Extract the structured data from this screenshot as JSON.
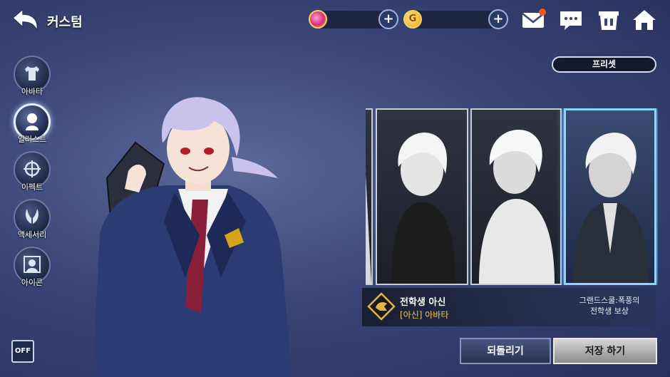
{
  "header": {
    "title": "커스텀",
    "gold_symbol": "G",
    "plus_label": "+"
  },
  "side_menu": [
    {
      "label": "아바타",
      "icon": "shirt-icon",
      "active": false
    },
    {
      "label": "일러스트",
      "icon": "portrait-icon",
      "active": true
    },
    {
      "label": "이펙트",
      "icon": "crosshair-icon",
      "active": false
    },
    {
      "label": "액세서리",
      "icon": "wings-icon",
      "active": false
    },
    {
      "label": "아이콘",
      "icon": "profile-icon",
      "active": false
    }
  ],
  "toggle": {
    "label": "OFF"
  },
  "preset": {
    "label": "프리셋"
  },
  "selected_costume": {
    "name": "전학생 아신",
    "type": "[아신] 아바타",
    "reward_line1": "그랜드스쿨:폭풍의",
    "reward_line2": "전학생 보상"
  },
  "buttons": {
    "revert": "되돌리기",
    "save": "저장 하기"
  },
  "colors": {
    "accent_gold": "#f2c94c",
    "selected_glow": "#8fd4ff",
    "notification": "#f25a1d"
  }
}
